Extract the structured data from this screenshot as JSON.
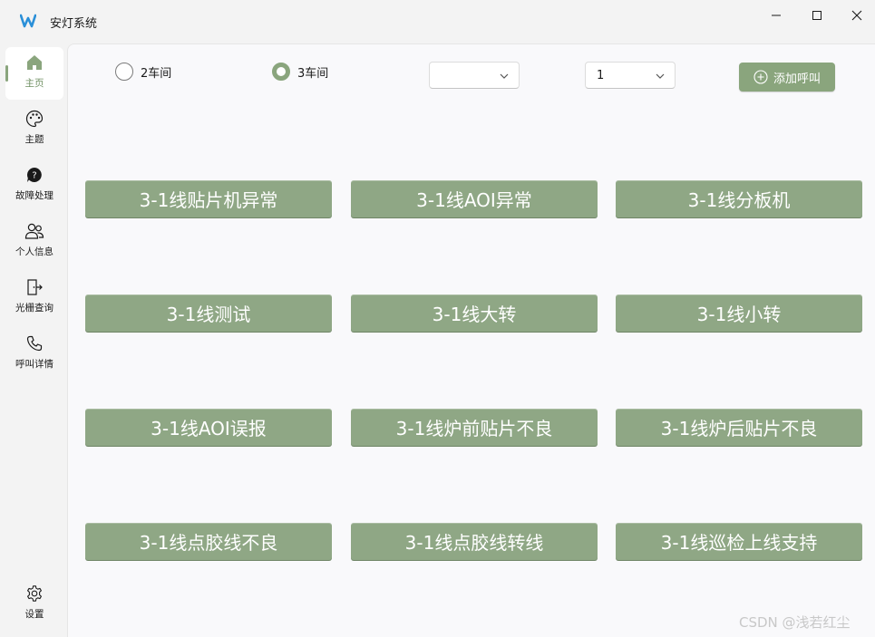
{
  "window": {
    "title": "安灯系统",
    "controls": [
      "minimize-icon",
      "maximize-icon",
      "close-icon"
    ]
  },
  "colors": {
    "accent": "#8aa57d",
    "button_bg": "#8fa785",
    "content_bg": "#f9f9fb",
    "chrome_bg": "#f3f3f3"
  },
  "sidebar": {
    "items": [
      {
        "label": "主页",
        "icon": "home-icon",
        "active": true
      },
      {
        "label": "主题",
        "icon": "palette-icon",
        "active": false
      },
      {
        "label": "故障处理",
        "icon": "help-chat-icon",
        "active": false
      },
      {
        "label": "个人信息",
        "icon": "people-icon",
        "active": false
      },
      {
        "label": "光栅查询",
        "icon": "door-exit-icon",
        "active": false
      },
      {
        "label": "呼叫详情",
        "icon": "phone-icon",
        "active": false
      }
    ],
    "settings": {
      "label": "设置",
      "icon": "gear-icon"
    }
  },
  "toolbar": {
    "workshops": [
      {
        "label": "2车间",
        "checked": false
      },
      {
        "label": "3车间",
        "checked": true
      }
    ],
    "combo1": {
      "value": ""
    },
    "combo2": {
      "value": "1"
    },
    "add_button": {
      "label": "添加呼叫",
      "icon": "add-circle-icon"
    }
  },
  "call_buttons": [
    "3-1线贴片机异常",
    "3-1线AOI异常",
    "3-1线分板机",
    "3-1线测试",
    "3-1线大转",
    "3-1线小转",
    "3-1线AOI误报",
    "3-1线炉前贴片不良",
    "3-1线炉后贴片不良",
    "3-1线点胶线不良",
    "3-1线点胶线转线",
    "3-1线巡检上线支持"
  ],
  "watermark": "CSDN @浅若红尘"
}
